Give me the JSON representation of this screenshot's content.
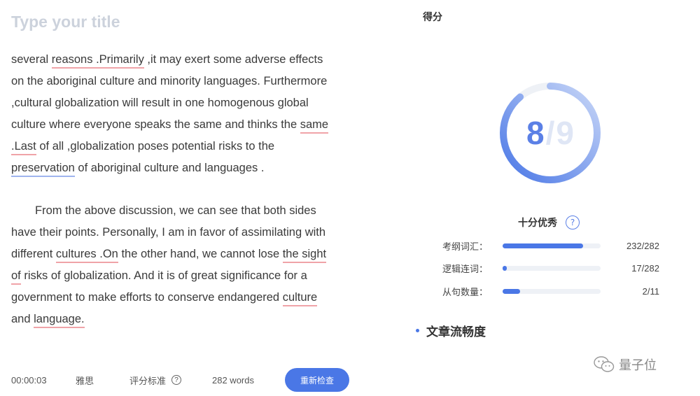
{
  "editor": {
    "title_placeholder": "Type your title",
    "paragraph1": [
      [
        {
          "t": "several "
        },
        {
          "t": "reasons .Primarily",
          "u": "red"
        },
        {
          "t": " ,it may exert some adverse effects"
        }
      ],
      [
        {
          "t": "on the aboriginal culture and minority languages. Furthermore"
        }
      ],
      [
        {
          "t": ",cultural globalization will result in one homogenous global"
        }
      ],
      [
        {
          "t": "culture where everyone speaks the same and thinks the "
        },
        {
          "t": "same",
          "u": "red"
        }
      ],
      [
        {
          "t": ".Last",
          "u": "red"
        },
        {
          "t": " of all ,globalization poses potential risks to the"
        }
      ],
      [
        {
          "t": "preservation",
          "u": "blue"
        },
        {
          "t": " of aboriginal culture and languages ."
        }
      ]
    ],
    "paragraph2": [
      [
        {
          "t": "From the above discussion, we can see that both sides"
        }
      ],
      [
        {
          "t": "have their points. Personally, I am in favor of assimilating with"
        }
      ],
      [
        {
          "t": "different "
        },
        {
          "t": "cultures .On",
          "u": "red"
        },
        {
          "t": " the other hand, we cannot lose "
        },
        {
          "t": "the sight",
          "u": "red"
        }
      ],
      [
        {
          "t": "of",
          "u": "red"
        },
        {
          "t": " risks of globalization. And it is of great significance for a"
        }
      ],
      [
        {
          "t": "government to make efforts to conserve endangered "
        },
        {
          "t": "culture",
          "u": "red"
        }
      ],
      [
        {
          "t": "and "
        },
        {
          "t": "language.",
          "u": "red"
        }
      ]
    ]
  },
  "footer": {
    "timer": "00:00:03",
    "exam": "雅思",
    "criteria_label": "评分标准",
    "help_glyph": "?",
    "word_count": "282 words",
    "recheck_label": "重新检查"
  },
  "score": {
    "title": "得分",
    "value": "8",
    "separator": "/",
    "max": "9",
    "fraction": 0.889,
    "rating": "十分优秀",
    "rating_help_glyph": "?"
  },
  "metrics": [
    {
      "label": "考纲词汇：",
      "value": "232/282",
      "fraction": 0.82
    },
    {
      "label": "逻辑连词：",
      "value": "17/282",
      "fraction": 0.04
    },
    {
      "label": "从句数量：",
      "value": "2/11",
      "fraction": 0.18
    }
  ],
  "section": {
    "title": "文章流畅度"
  },
  "watermark": {
    "text": "量子位",
    "icon": "wechat-icon"
  },
  "colors": {
    "accent": "#4a77e6",
    "underline_red": "#f0a3a8",
    "underline_blue": "#9fb4ee",
    "track": "#eef1f6"
  }
}
